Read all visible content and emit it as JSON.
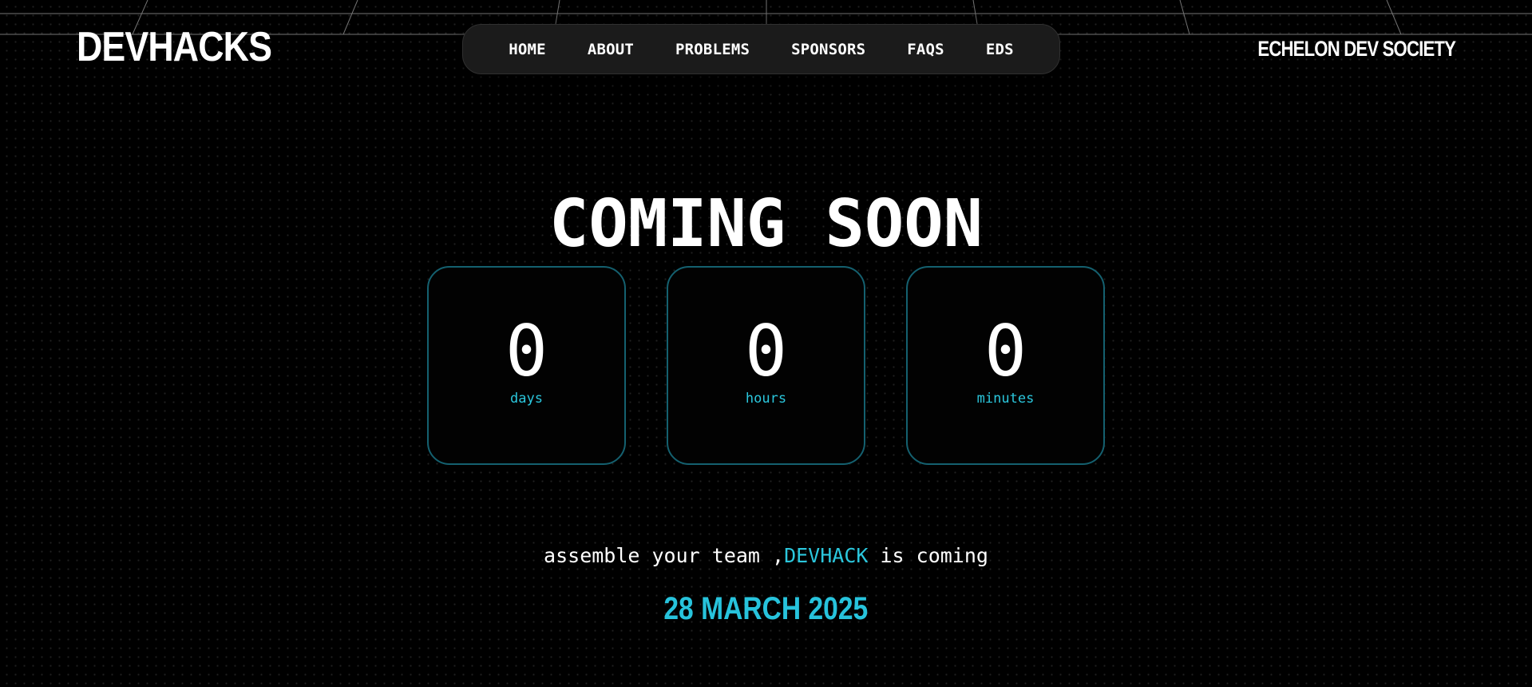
{
  "header": {
    "logo": "DEVHACKS",
    "brand_right": "ECHELON DEV SOCIETY"
  },
  "nav": {
    "items": [
      {
        "label": "HOME"
      },
      {
        "label": "ABOUT"
      },
      {
        "label": "PROBLEMS"
      },
      {
        "label": "SPONSORS"
      },
      {
        "label": "FAQS"
      },
      {
        "label": "EDS"
      }
    ]
  },
  "hero": {
    "headline": "COMING SOON"
  },
  "countdown": {
    "days": {
      "value": "0",
      "unit": "days"
    },
    "hours": {
      "value": "0",
      "unit": "hours"
    },
    "minutes": {
      "value": "0",
      "unit": "minutes"
    }
  },
  "tagline": {
    "before": "assemble your team ,",
    "accent": "DEVHACK",
    "after": " is coming"
  },
  "event": {
    "date": "28 MARCH 2025"
  },
  "colors": {
    "background": "#000000",
    "accent": "#2bc7dd",
    "box_border": "#14606f",
    "nav_background": "#1b1b1b"
  }
}
